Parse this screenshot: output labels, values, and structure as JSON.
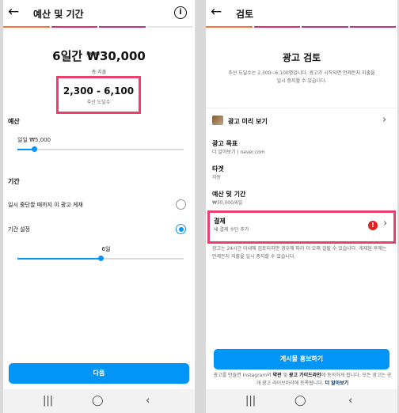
{
  "budget_screen": {
    "title": "예산 및 기간",
    "headline": "6일간 ₩30,000",
    "total_spend_label": "총 지출",
    "reach_range": "2,300 - 6,100",
    "reach_label": "추산 도달수",
    "budget_section": "예산",
    "daily_budget": "일일 ₩5,000",
    "daily_budget_fraction": 0.1,
    "duration_section": "기간",
    "option_until_paused": "일시 중단할 때까지 이 광고 게재",
    "option_set_duration": "기간 설정",
    "duration_value": "6일",
    "duration_fraction": 0.5,
    "next_button": "다음"
  },
  "review_screen": {
    "title": "검토",
    "heading": "광고 검토",
    "intro": "추산 도달수는 2,300~6,100명입니다. 광고가 시작되면 언제든지 지출을 일시 중지할 수 있습니다.",
    "preview_label": "광고 미리 보기",
    "goal_label": "광고 목표",
    "goal_value": "더 알아보기 | naver.com",
    "target_label": "타겟",
    "target_value": "자동",
    "budget_label": "예산 및 기간",
    "budget_value": "₩30,000/6일",
    "payment_label": "결제",
    "payment_value": "새 결제 수단 추가",
    "review_note": "광고는 24시간 이내에 검토되지만 경우에 따라 더 오래 걸릴 수 있습니다. 게재된 후에는 언제든지 지출을 일시 중지할 수 있습니다.",
    "promote_button": "게시물 홍보하기",
    "footer_1": "광고를 만들면 Instagram의",
    "footer_terms": "약관",
    "footer_and": "및",
    "footer_guidelines": "광고 가이드라인",
    "footer_2": "에 동의하게 됩니다. 모든 광고는 공개 광고 라이브러리에 등록됩니다.",
    "footer_learn": "더 알아보기"
  },
  "icons": {
    "back": "back-arrow-icon",
    "info": "info-icon",
    "chevron": "chevron-right-icon",
    "warning": "warning-icon",
    "nav_recent": "recent-apps-icon",
    "nav_home": "home-icon",
    "nav_back": "nav-back-icon"
  },
  "colors": {
    "accent": "#0095f6",
    "highlight": "#e8416e",
    "warning": "#e02222"
  }
}
